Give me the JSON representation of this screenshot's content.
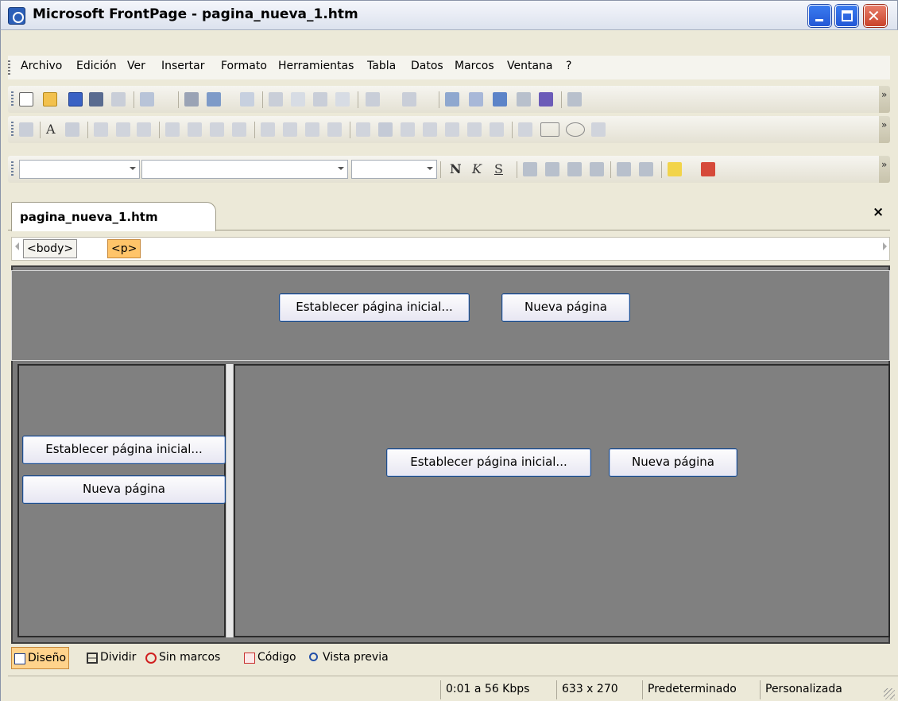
{
  "window": {
    "title": "Microsoft FrontPage - pagina_nueva_1.htm"
  },
  "menu": {
    "items": [
      "Archivo",
      "Edición",
      "Ver",
      "Insertar",
      "Formato",
      "Herramientas",
      "Tabla",
      "Datos",
      "Marcos",
      "Ventana",
      "?"
    ]
  },
  "formatting_toolbar": {
    "style_value": "",
    "font_value": "",
    "size_value": "",
    "bold_glyph": "N",
    "italic_glyph": "K",
    "underline_glyph": "S"
  },
  "document": {
    "tab_label": "pagina_nueva_1.htm",
    "close_glyph": "×",
    "tags": [
      "<body>",
      "<p>"
    ]
  },
  "frames": {
    "top": {
      "set_initial": "Establecer página inicial...",
      "new_page": "Nueva página"
    },
    "left": {
      "set_initial": "Establecer página inicial...",
      "new_page": "Nueva página"
    },
    "main": {
      "set_initial": "Establecer página inicial...",
      "new_page": "Nueva página"
    }
  },
  "view_tabs": [
    "Diseño",
    "Dividir",
    "Sin marcos",
    "Código",
    "Vista previa"
  ],
  "status": {
    "download_time": "0:01 a 56 Kbps",
    "page_size": "633 x 270",
    "mode": "Predeterminado",
    "custom": "Personalizada"
  },
  "colors": {
    "frame_background": "#808080",
    "active_tag": "#FFC469",
    "xp_blue": "#2358D6"
  }
}
